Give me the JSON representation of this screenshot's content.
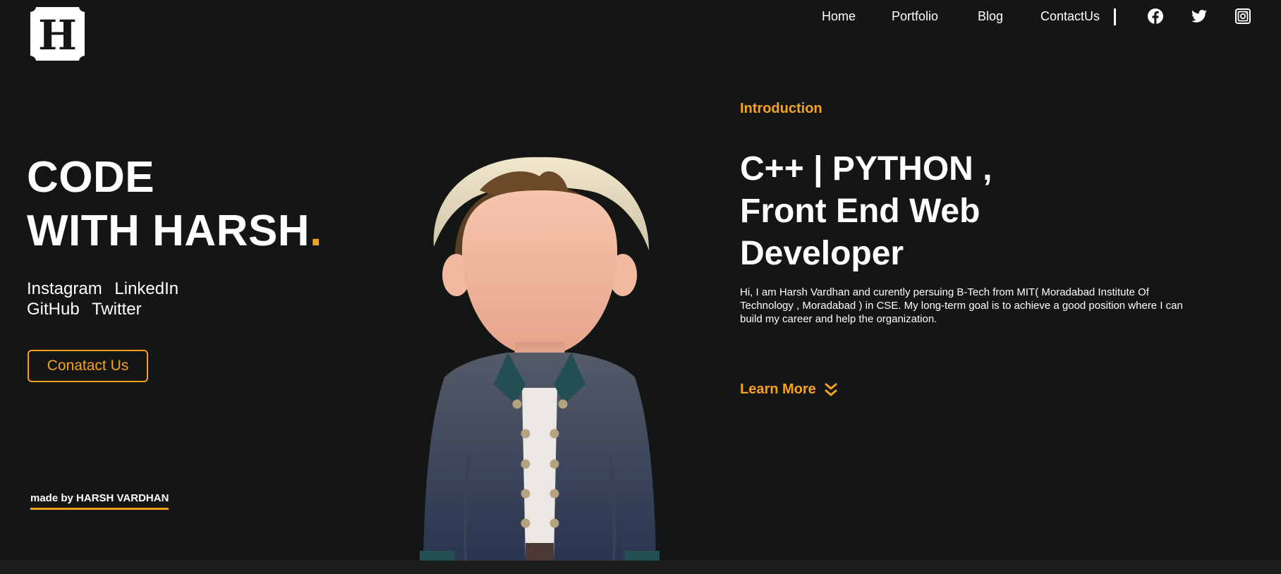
{
  "header": {
    "logo_letter": "H",
    "nav": [
      "Home",
      "Portfolio",
      "Blog",
      "ContactUs"
    ],
    "social_icons": [
      "facebook-icon",
      "twitter-icon",
      "instagram-icon"
    ]
  },
  "hero": {
    "title_line1": "CODE",
    "title_line2": "WITH HARSH",
    "title_dot": ".",
    "links": [
      "Instagram",
      "LinkedIn",
      "GitHub",
      "Twitter"
    ],
    "cta_label": "Conatact Us",
    "made_by": "made by HARSH VARDHAN"
  },
  "about": {
    "intro_label": "Introduction",
    "headline_1": "C++ | PYTHON ,",
    "headline_2": "Front End Web",
    "headline_3": "Developer",
    "bio": "Hi, I am Harsh Vardhan and curently persuing B-Tech from MIT( Moradabad Institute Of Technology , Moradabad ) in CSE. My long-term goal is to achieve a good position where I can build my career and help the organization.",
    "learn_more": "Learn More"
  },
  "colors": {
    "background": "#141515",
    "accent": "#f7a21d",
    "text": "#ffffff"
  }
}
